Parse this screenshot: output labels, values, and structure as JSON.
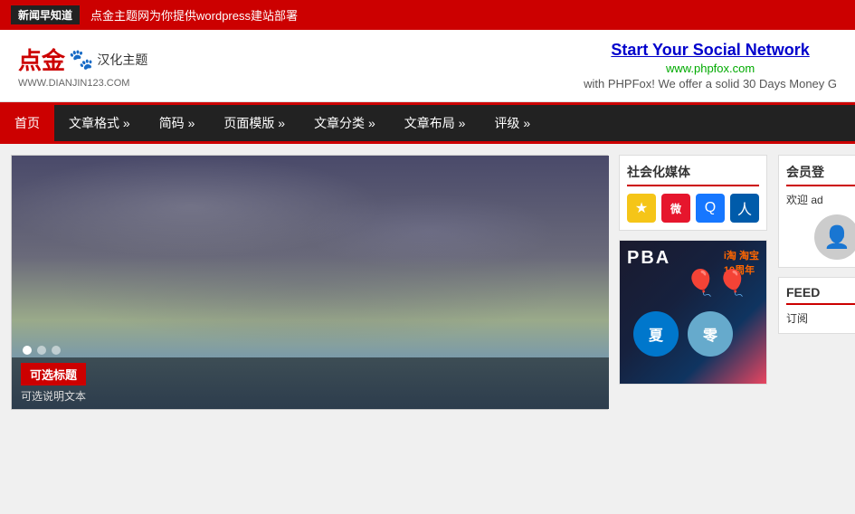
{
  "topbar": {
    "tag": "新闻早知道",
    "text": "点金主题网为你提供wordpress建站部署"
  },
  "header": {
    "logo_main": "点金",
    "logo_sub": "汉化主题",
    "logo_paw": "🐾",
    "logo_url": "WWW.DIANJIN123.COM",
    "social_link": "Start Your Social Network",
    "phpfox_url": "www.phpfox.com",
    "desc": "with PHPFox! We offer a solid 30 Days Money G"
  },
  "nav": {
    "items": [
      {
        "label": "首页",
        "active": true
      },
      {
        "label": "文章格式 »",
        "active": false
      },
      {
        "label": "简码 »",
        "active": false
      },
      {
        "label": "页面模版 »",
        "active": false
      },
      {
        "label": "文章分类 »",
        "active": false
      },
      {
        "label": "文章布局 »",
        "active": false
      },
      {
        "label": "评级 »",
        "active": false
      }
    ]
  },
  "featured": {
    "dots": 3,
    "caption_title": "可选标题",
    "caption_sub": "可选说明文本"
  },
  "sidebar": {
    "social_title": "社会化媒体",
    "social_icons": [
      {
        "name": "收藏",
        "type": "star"
      },
      {
        "name": "微博",
        "type": "weibo"
      },
      {
        "name": "QQ",
        "type": "qq"
      },
      {
        "name": "人人",
        "type": "ren"
      }
    ],
    "ad_pba": "PBA",
    "ad_taobao": "i淘 淘宝\n10周年",
    "ad_summer": "夏",
    "ad_zero": "零"
  },
  "sidebar2": {
    "member_title": "会员登",
    "welcome": "欢迎 ad",
    "feed_title": "FEED",
    "feed_text": "订阅"
  }
}
